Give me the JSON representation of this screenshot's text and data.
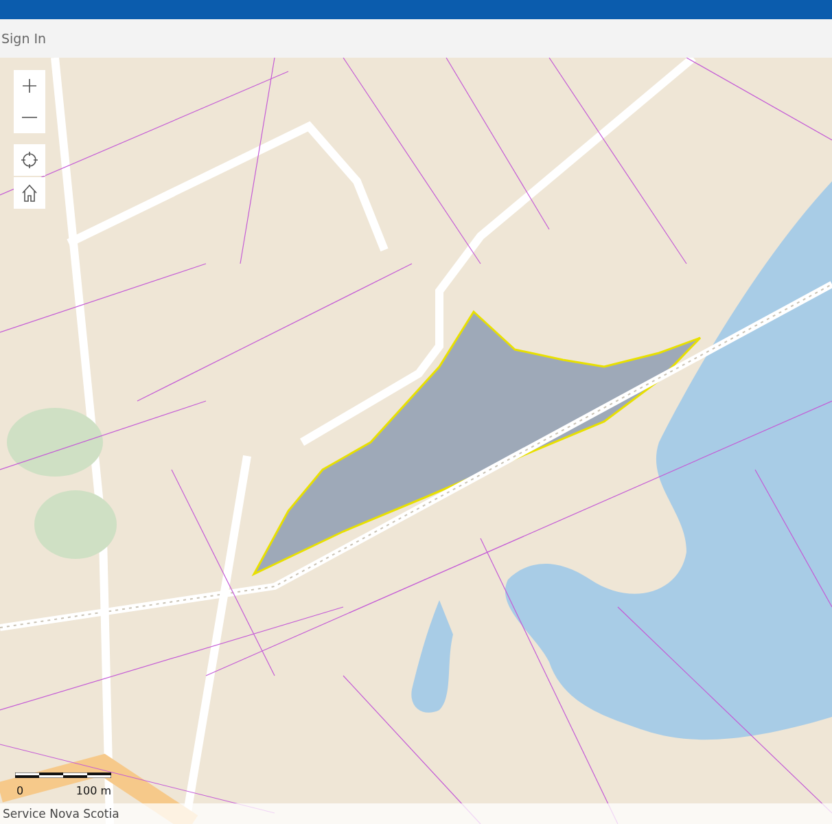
{
  "header": {
    "sign_in": "Sign In"
  },
  "map_controls": [
    {
      "kind": "zoom-in"
    },
    {
      "kind": "zoom-out"
    },
    {
      "kind": "locate"
    },
    {
      "kind": "home"
    }
  ],
  "scale_bar": {
    "start": "0",
    "end": "100 m"
  },
  "attribution": "Service Nova Scotia"
}
